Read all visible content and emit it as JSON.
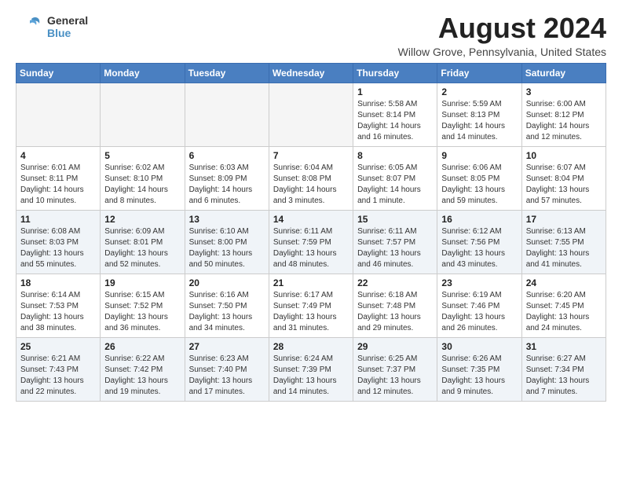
{
  "header": {
    "logo_line1": "General",
    "logo_line2": "Blue",
    "month_year": "August 2024",
    "location": "Willow Grove, Pennsylvania, United States"
  },
  "days_of_week": [
    "Sunday",
    "Monday",
    "Tuesday",
    "Wednesday",
    "Thursday",
    "Friday",
    "Saturday"
  ],
  "weeks": [
    [
      {
        "day": "",
        "empty": true
      },
      {
        "day": "",
        "empty": true
      },
      {
        "day": "",
        "empty": true
      },
      {
        "day": "",
        "empty": true
      },
      {
        "day": "1",
        "sunrise": "5:58 AM",
        "sunset": "8:14 PM",
        "daylight": "14 hours and 16 minutes."
      },
      {
        "day": "2",
        "sunrise": "5:59 AM",
        "sunset": "8:13 PM",
        "daylight": "14 hours and 14 minutes."
      },
      {
        "day": "3",
        "sunrise": "6:00 AM",
        "sunset": "8:12 PM",
        "daylight": "14 hours and 12 minutes."
      }
    ],
    [
      {
        "day": "4",
        "sunrise": "6:01 AM",
        "sunset": "8:11 PM",
        "daylight": "14 hours and 10 minutes."
      },
      {
        "day": "5",
        "sunrise": "6:02 AM",
        "sunset": "8:10 PM",
        "daylight": "14 hours and 8 minutes."
      },
      {
        "day": "6",
        "sunrise": "6:03 AM",
        "sunset": "8:09 PM",
        "daylight": "14 hours and 6 minutes."
      },
      {
        "day": "7",
        "sunrise": "6:04 AM",
        "sunset": "8:08 PM",
        "daylight": "14 hours and 3 minutes."
      },
      {
        "day": "8",
        "sunrise": "6:05 AM",
        "sunset": "8:07 PM",
        "daylight": "14 hours and 1 minute."
      },
      {
        "day": "9",
        "sunrise": "6:06 AM",
        "sunset": "8:05 PM",
        "daylight": "13 hours and 59 minutes."
      },
      {
        "day": "10",
        "sunrise": "6:07 AM",
        "sunset": "8:04 PM",
        "daylight": "13 hours and 57 minutes."
      }
    ],
    [
      {
        "day": "11",
        "sunrise": "6:08 AM",
        "sunset": "8:03 PM",
        "daylight": "13 hours and 55 minutes."
      },
      {
        "day": "12",
        "sunrise": "6:09 AM",
        "sunset": "8:01 PM",
        "daylight": "13 hours and 52 minutes."
      },
      {
        "day": "13",
        "sunrise": "6:10 AM",
        "sunset": "8:00 PM",
        "daylight": "13 hours and 50 minutes."
      },
      {
        "day": "14",
        "sunrise": "6:11 AM",
        "sunset": "7:59 PM",
        "daylight": "13 hours and 48 minutes."
      },
      {
        "day": "15",
        "sunrise": "6:11 AM",
        "sunset": "7:57 PM",
        "daylight": "13 hours and 46 minutes."
      },
      {
        "day": "16",
        "sunrise": "6:12 AM",
        "sunset": "7:56 PM",
        "daylight": "13 hours and 43 minutes."
      },
      {
        "day": "17",
        "sunrise": "6:13 AM",
        "sunset": "7:55 PM",
        "daylight": "13 hours and 41 minutes."
      }
    ],
    [
      {
        "day": "18",
        "sunrise": "6:14 AM",
        "sunset": "7:53 PM",
        "daylight": "13 hours and 38 minutes."
      },
      {
        "day": "19",
        "sunrise": "6:15 AM",
        "sunset": "7:52 PM",
        "daylight": "13 hours and 36 minutes."
      },
      {
        "day": "20",
        "sunrise": "6:16 AM",
        "sunset": "7:50 PM",
        "daylight": "13 hours and 34 minutes."
      },
      {
        "day": "21",
        "sunrise": "6:17 AM",
        "sunset": "7:49 PM",
        "daylight": "13 hours and 31 minutes."
      },
      {
        "day": "22",
        "sunrise": "6:18 AM",
        "sunset": "7:48 PM",
        "daylight": "13 hours and 29 minutes."
      },
      {
        "day": "23",
        "sunrise": "6:19 AM",
        "sunset": "7:46 PM",
        "daylight": "13 hours and 26 minutes."
      },
      {
        "day": "24",
        "sunrise": "6:20 AM",
        "sunset": "7:45 PM",
        "daylight": "13 hours and 24 minutes."
      }
    ],
    [
      {
        "day": "25",
        "sunrise": "6:21 AM",
        "sunset": "7:43 PM",
        "daylight": "13 hours and 22 minutes."
      },
      {
        "day": "26",
        "sunrise": "6:22 AM",
        "sunset": "7:42 PM",
        "daylight": "13 hours and 19 minutes."
      },
      {
        "day": "27",
        "sunrise": "6:23 AM",
        "sunset": "7:40 PM",
        "daylight": "13 hours and 17 minutes."
      },
      {
        "day": "28",
        "sunrise": "6:24 AM",
        "sunset": "7:39 PM",
        "daylight": "13 hours and 14 minutes."
      },
      {
        "day": "29",
        "sunrise": "6:25 AM",
        "sunset": "7:37 PM",
        "daylight": "13 hours and 12 minutes."
      },
      {
        "day": "30",
        "sunrise": "6:26 AM",
        "sunset": "7:35 PM",
        "daylight": "13 hours and 9 minutes."
      },
      {
        "day": "31",
        "sunrise": "6:27 AM",
        "sunset": "7:34 PM",
        "daylight": "13 hours and 7 minutes."
      }
    ]
  ]
}
